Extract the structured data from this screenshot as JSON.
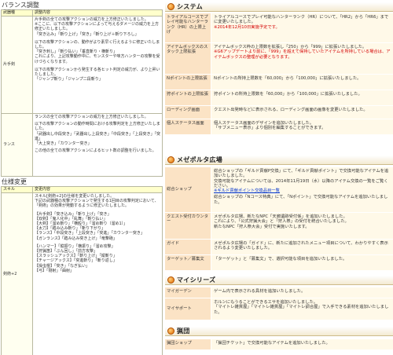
{
  "left": {
    "balance_title": "バランス調整",
    "balance_headers": [
      "武器種",
      "調整内容"
    ],
    "katate": {
      "name": "片手剣",
      "lines": [
        "片手剣の全ての攻撃アクションの威力を上方修正いたしました。",
        "※ここに、以下の攻撃アクションによって与えるダメージの威力を上方修正いたしました。",
        "「突き込み」「斬り上げ」「突き」「斬り上げ＋斬り下ろし」",
        "以下の攻撃アクションの、動作がより素早く行えるように修正いたしました。",
        "「突き刺し」「斬り払い」「垂直斬り・横斬り」",
        "これにより、上記攻撃動作中に、モンスターや味方ハンターの攻撃を受けづらくなります。",
        "以下の攻撃アクションから発生する各ヒット判定の威力が、より上昇いたしました。",
        "「ジャンプ斬り」「ジャンプ二段斬り」"
      ]
    },
    "lance": {
      "name": "ランス",
      "lines": [
        "ランスの全ての攻撃アクションの威力を上方修正いたしました。",
        "以下の攻撃アクションの動作時間における攻撃判定を上方修正いたしました。",
        "「武器出し中段突き」「武器出し上段突き」「中段突き」「上段突き」「突進」",
        "「大上突き」「カウンター突き」",
        "この他の全ての攻撃アクションによるヒット数の調整を行いました。"
      ]
    },
    "spec_title": "仕様変更",
    "spec_headers": [
      "スキル",
      "変更内容"
    ],
    "spec": {
      "name": "剣術+2",
      "lines": [
        "スキル[剣術+2]の仕様を変更いたしました。",
        "下記の武器種の攻撃アクションで発生する1回目の攻撃判定において、",
        "「剣術」の効果が発動するように修正いたしました。",
        "【片手剣】「突き込み」「斬り上げ」「突き」",
        "【双剣】「鬼人化中」「乱舞」「斬り払い」",
        "【大剣】「溜め斬り」「横殴り」「溜め斬り（溜め1）」",
        "【太刀】「踏み込み斬り」「斬り下がり」",
        "【ランス】「中段突き」「上段突き」「突進」「カウンター突き」",
        "【ガンランス】「踏み込み突き上げ」「竜撃砲」",
        "【ハンマー】「縦振り」「横振り」「溜め攻撃」",
        "【狩猟笛】「ぶん回し」「前方攻撃」",
        "【スラッシュアックス】「斬り上げ」「縦斬り」",
        "【チャージアックス】「突進斬り」「斬り返し」",
        "【操虫棍】「突き」「なぎ払い」",
        "【弓】「剛射」「曲射」"
      ]
    }
  },
  "right": {
    "system": {
      "title": "システム",
      "rows": [
        {
          "label": "トライアルコースでプレイ可能なハンターランク（HR）の上限上げ",
          "lines": [
            "トライアルコースでプレイ可能なハンターランク（HR）について、「HR2」から「HR6」までに変更いたしました。"
          ],
          "note": "※2014年12月10日実施予定です。"
        },
        {
          "label": "アイテムボックスのスタック上限拡張",
          "lines": [
            "アイテムボックス枠の上限数を拡張し「250」から「999」に拡張いたしました。"
          ],
          "note": "※G6アップデートより前に、「999」を超えて保持していたアイテムを所持している場合は、アイテムボックスの整理が必要となります。"
        },
        {
          "label": "Nポイントの上限拡張",
          "lines": [
            "Nポイントの所持上限数を「60,000」から「100,000」に拡張いたしました。"
          ],
          "note": ""
        },
        {
          "label": "狩ポイントの上限拡張",
          "lines": [
            "狩ポイントの所持上限数を「60,000」から「100,000」に拡張いたしました。"
          ],
          "note": ""
        },
        {
          "label": "ローディング画面",
          "lines": [
            "クエスト出発時などに表示される、ローディング画面の画像を変更いたしました。"
          ],
          "note": ""
        },
        {
          "label": "個人ステータス画面",
          "lines": [
            "個人ステータス画面のデザインを追加いたしました。",
            "「サブメニュー表示」より個別を編集することができます。"
          ],
          "note": ""
        }
      ]
    },
    "mezeporta": {
      "title": "メゼポルタ広場",
      "rows": [
        {
          "label": "総合ショップ",
          "lines": [
            "総合ショップの「ギルド貢献P交換」にて、「ギルド貢献ポイント」で交換可能なアイテムを追加いたしました。",
            "交換可能なアイテムについては、2014年11月19日（水）以降のアイテム交換の一覧をご覧ください。"
          ],
          "link": "※ギルド貢献ポイント交換品目一覧",
          "extra": [
            "総合ショップの「Nコース特典」にて、「Nポイント」で交換可能なアイテムを追加いたしました。"
          ]
        },
        {
          "label": "クエスト受付カウンター",
          "lines": [
            "メゼポルタ広場、新たなNPC「天廊遺跡受付係」を追加いたしました。",
            "これにより、「公式狩猟大会」と「狩人祭」の受付を統合いたしました。",
            "新たなNPC「狩人祭大会」受付で実施いたします。"
          ],
          "link": "",
          "extra": []
        },
        {
          "label": "ガイド",
          "lines": [
            "メゼポルタ広場の「ガイド」に、新たに追加されたメニュー項目について、わかりやすく表示されるよう変更いたしました。"
          ],
          "link": "",
          "extra": []
        },
        {
          "label": "ターゲット／募集文",
          "lines": [
            "「ターゲット」と「募集文」で、選択可能な項目を追加いたしました。"
          ],
          "link": "",
          "extra": []
        }
      ]
    },
    "myseries": {
      "title": "マイシリーズ",
      "rows": [
        {
          "label": "マイガーデン",
          "lines": [
            "ゲーム内で表示される具材を追加いたしました。"
          ]
        },
        {
          "label": "マイサポート",
          "lines": [
            "ホルンにもうることができるエサを追加いたしました。",
            "「マイトレ雑貨屋」「マイトレ雑貨屋」「マイトレ調合屋」で入手できる素材を追加いたしました。"
          ]
        }
      ]
    },
    "kyodan": {
      "title": "猟団",
      "rows": [
        {
          "label": "猟団ショップ",
          "lines": [
            "「猟団チケット」で交換可能なアイテムを追加いたしました。"
          ]
        }
      ]
    }
  }
}
